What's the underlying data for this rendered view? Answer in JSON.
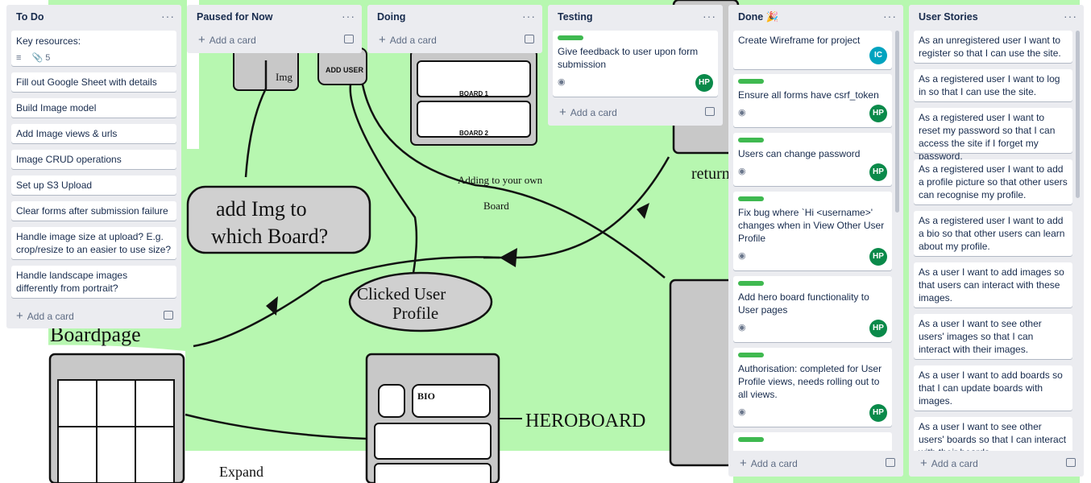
{
  "lists": {
    "todo": {
      "title": "To Do",
      "menu": "···",
      "add": "Add a card",
      "cards": [
        "Key resources:",
        "Fill out Google Sheet with details",
        "Build Image model",
        "Add Image views & urls",
        "Image CRUD operations",
        "Set up S3 Upload",
        "Clear forms after submission failure",
        "Handle image size at upload? E.g. crop/resize to an easier to use size?",
        "Handle landscape images differently from portrait?"
      ],
      "attachments": "5"
    },
    "paused": {
      "title": "Paused for Now",
      "menu": "···",
      "add": "Add a card"
    },
    "doing": {
      "title": "Doing",
      "menu": "···",
      "add": "Add a card"
    },
    "testing": {
      "title": "Testing",
      "menu": "···",
      "add": "Add a card",
      "cards": [
        {
          "text": "Give feedback to user upon form submission",
          "avatar": "HP"
        }
      ]
    },
    "done": {
      "title": "Done 🎉",
      "menu": "···",
      "add": "Add a card",
      "cards": [
        {
          "text": "Create Wireframe for project",
          "avatar": "IC"
        },
        {
          "text": "Ensure all forms have csrf_token",
          "avatar": "HP"
        },
        {
          "text": "Users can change password",
          "avatar": "HP"
        },
        {
          "text": "Fix bug where `Hi <username>' changes when in View Other User Profile",
          "avatar": "HP"
        },
        {
          "text": "Add hero board functionality to User pages",
          "avatar": "HP"
        },
        {
          "text": "Authorisation: completed for User Profile views, needs rolling out to all views.",
          "avatar": "HP"
        }
      ]
    },
    "stories": {
      "title": "User Stories",
      "menu": "···",
      "add": "Add a card",
      "cards": [
        "As an unregistered user I want to register so that I can use the site.",
        "As a registered user I want to log in so that I can use the site.",
        "As a registered user I want to reset my password so that I can access the site if I forget my password.",
        "As a registered user I want to add a profile picture so that other users can recognise my profile.",
        "As a registered user I want to add a bio so that other users can learn about my profile.",
        "As a user I want to add images so that users can interact with these images.",
        "As a user I want to see other users' images so that I can interact with their images.",
        "As a user I want to add boards so that I can update boards with images.",
        "As a user I want to see other users' boards so that I can interact with their boards"
      ]
    }
  },
  "wireframe": {
    "add_img": "add Img to\nwhich Board?",
    "clicked": "Clicked User Profile",
    "adding": "Adding to your own Board",
    "heroboard": "HEROBOARD",
    "boardpage": "Boardpage",
    "expand": "Expand",
    "return": "return",
    "add_user": "ADD USER",
    "img": "Img",
    "board1": "BOARD 1",
    "board2": "BOARD 2",
    "bio": "BIO"
  },
  "colors": {
    "green_label": "#3fb950",
    "avatar_hp": "#0a8a4a",
    "avatar_ic": "#00a3bf",
    "list_bg": "#ebecf0",
    "board_bg": "#b7f7b0"
  }
}
